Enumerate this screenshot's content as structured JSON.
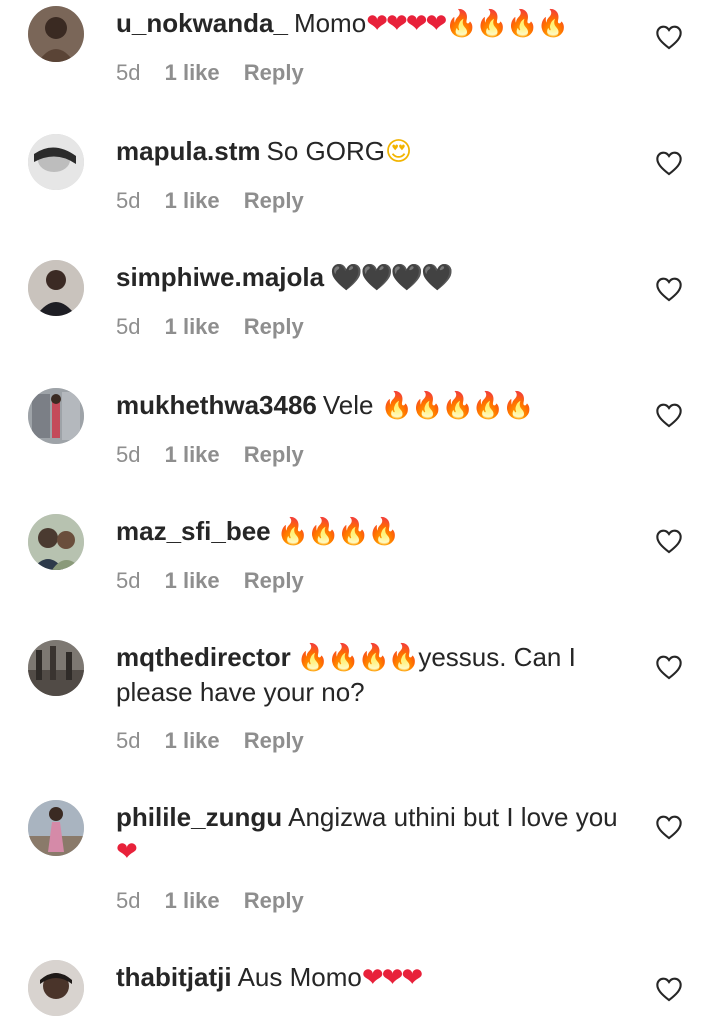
{
  "comments": [
    {
      "username": "u_nokwanda_",
      "text": "Momo",
      "emoji": "❤❤❤❤🔥🔥🔥🔥",
      "emoji_style": "mixed-red-fire",
      "time": "5d",
      "likes": "1 like",
      "reply": "Reply",
      "avatar_color": "#3a2a22"
    },
    {
      "username": "mapula.stm",
      "text": "So GORG",
      "emoji": "😍",
      "emoji_style": "face",
      "time": "5d",
      "likes": "1 like",
      "reply": "Reply",
      "avatar_color": "#d9d9d9"
    },
    {
      "username": "simphiwe.majola",
      "text": "",
      "emoji": "🖤🖤🖤🖤",
      "emoji_style": "black",
      "time": "5d",
      "likes": "1 like",
      "reply": "Reply",
      "avatar_color": "#2b2220"
    },
    {
      "username": "mukhethwa3486",
      "text": "Vele",
      "emoji": "🔥🔥🔥🔥🔥",
      "emoji_style": "fire",
      "time": "5d",
      "likes": "1 like",
      "reply": "Reply",
      "avatar_color": "#8a8f96"
    },
    {
      "username": "maz_sfi_bee",
      "text": "",
      "emoji": "🔥🔥🔥🔥",
      "emoji_style": "fire",
      "time": "5d",
      "likes": "1 like",
      "reply": "Reply",
      "avatar_color": "#6f7a6a"
    },
    {
      "username": "mqthedirector",
      "text": "yessus. Can I please have your no?",
      "emoji": "🔥🔥🔥🔥",
      "emoji_style": "fire-before",
      "time": "5d",
      "likes": "1 like",
      "reply": "Reply",
      "avatar_color": "#6b6560"
    },
    {
      "username": "philile_zungu",
      "text": "Angizwa uthini but I love you",
      "emoji": "❤",
      "emoji_style": "red",
      "time": "5d",
      "likes": "1 like",
      "reply": "Reply",
      "avatar_color": "#9aa4b0"
    },
    {
      "username": "thabitjatji",
      "text": "Aus Momo",
      "emoji": "❤❤❤",
      "emoji_style": "red",
      "time": "",
      "likes": "",
      "reply": "",
      "avatar_color": "#c7c2bd"
    }
  ],
  "icons": {
    "like": "heart-outline-icon"
  },
  "colors": {
    "text": "#262626",
    "meta": "#8e8e8e",
    "heart_red": "#e8213a",
    "fire": "#f45a17"
  }
}
